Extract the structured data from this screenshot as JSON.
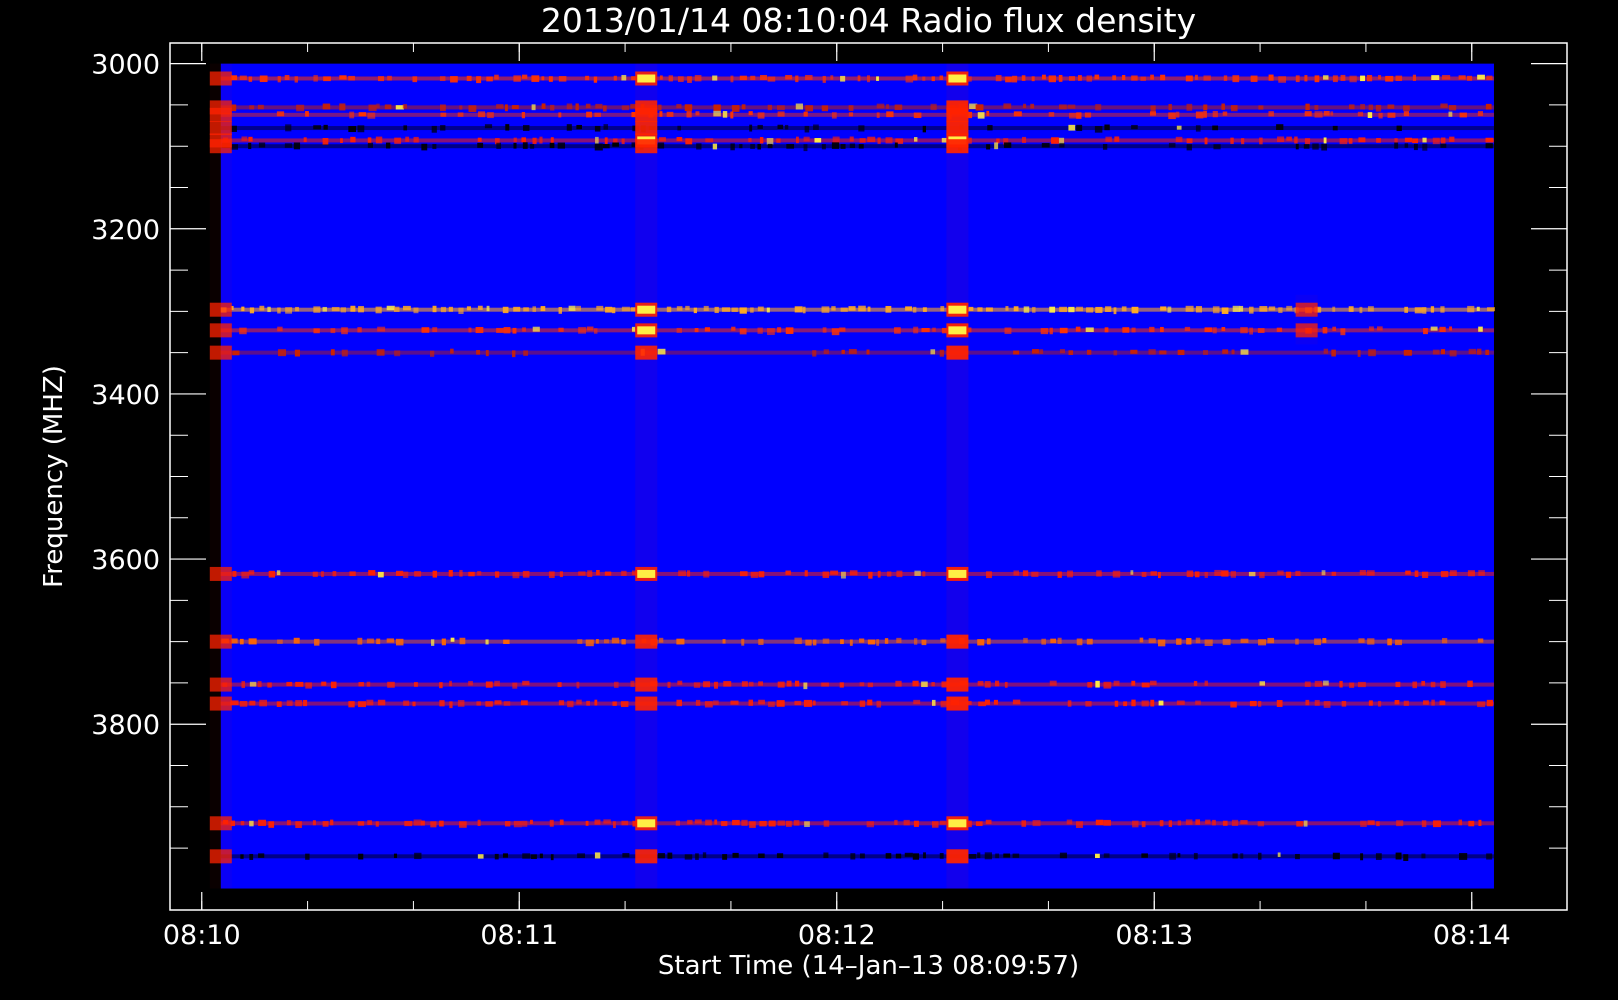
{
  "chart_data": {
    "type": "heatmap",
    "title": "2013/01/14 08:10:04 Radio flux density",
    "xlabel": "Start Time (14–Jan–13 08:09:57)",
    "ylabel": "Frequency (MHZ)",
    "x_ticks": [
      "08:10",
      "08:11",
      "08:12",
      "08:13",
      "08:14"
    ],
    "y_ticks": [
      3000,
      3200,
      3400,
      3600,
      3800
    ],
    "y_range": [
      2975,
      4025
    ],
    "x_range_minutes": [
      -0.1,
      4.3
    ],
    "y_inverted": true,
    "data_time_range_minutes": [
      0.06,
      4.07
    ],
    "data_freq_range": [
      3000,
      3999
    ],
    "background_color": "#0000ff",
    "colormap": [
      "#000000",
      "#0000ff",
      "#cc0000",
      "#ff4400",
      "#ffee44",
      "#ffffff"
    ],
    "bands": [
      {
        "freq": 3018,
        "intensity": 0.7,
        "color": "#ff3300"
      },
      {
        "freq": 3053,
        "intensity": 0.5,
        "color": "#cc2200"
      },
      {
        "freq": 3062,
        "intensity": 0.4,
        "color": "#ff3300"
      },
      {
        "freq": 3078,
        "intensity": 0.3,
        "color": "#000000"
      },
      {
        "freq": 3093,
        "intensity": 0.6,
        "color": "#ff2200"
      },
      {
        "freq": 3100,
        "intensity": 0.4,
        "color": "#000000"
      },
      {
        "freq": 3298,
        "intensity": 0.8,
        "color": "#ffaa22"
      },
      {
        "freq": 3323,
        "intensity": 0.6,
        "color": "#ff3300"
      },
      {
        "freq": 3350,
        "intensity": 0.3,
        "color": "#cc2200"
      },
      {
        "freq": 3618,
        "intensity": 0.6,
        "color": "#ff2200"
      },
      {
        "freq": 3700,
        "intensity": 0.5,
        "color": "#ff6600"
      },
      {
        "freq": 3752,
        "intensity": 0.5,
        "color": "#ff2200"
      },
      {
        "freq": 3775,
        "intensity": 0.5,
        "color": "#ff2200"
      },
      {
        "freq": 3920,
        "intensity": 0.6,
        "color": "#ff2200"
      },
      {
        "freq": 3960,
        "intensity": 0.4,
        "color": "#000000"
      }
    ],
    "bursts": [
      {
        "time_minutes": 0.06,
        "freq_range": [
          3000,
          4000
        ],
        "intensity": 0.5
      },
      {
        "time_minutes": 1.4,
        "freq_range": [
          3000,
          4000
        ],
        "intensity": 0.8
      },
      {
        "time_minutes": 2.38,
        "freq_range": [
          3000,
          4000
        ],
        "intensity": 0.9
      },
      {
        "time_minutes": 3.48,
        "freq_range": [
          3280,
          3340
        ],
        "intensity": 0.5
      }
    ]
  }
}
